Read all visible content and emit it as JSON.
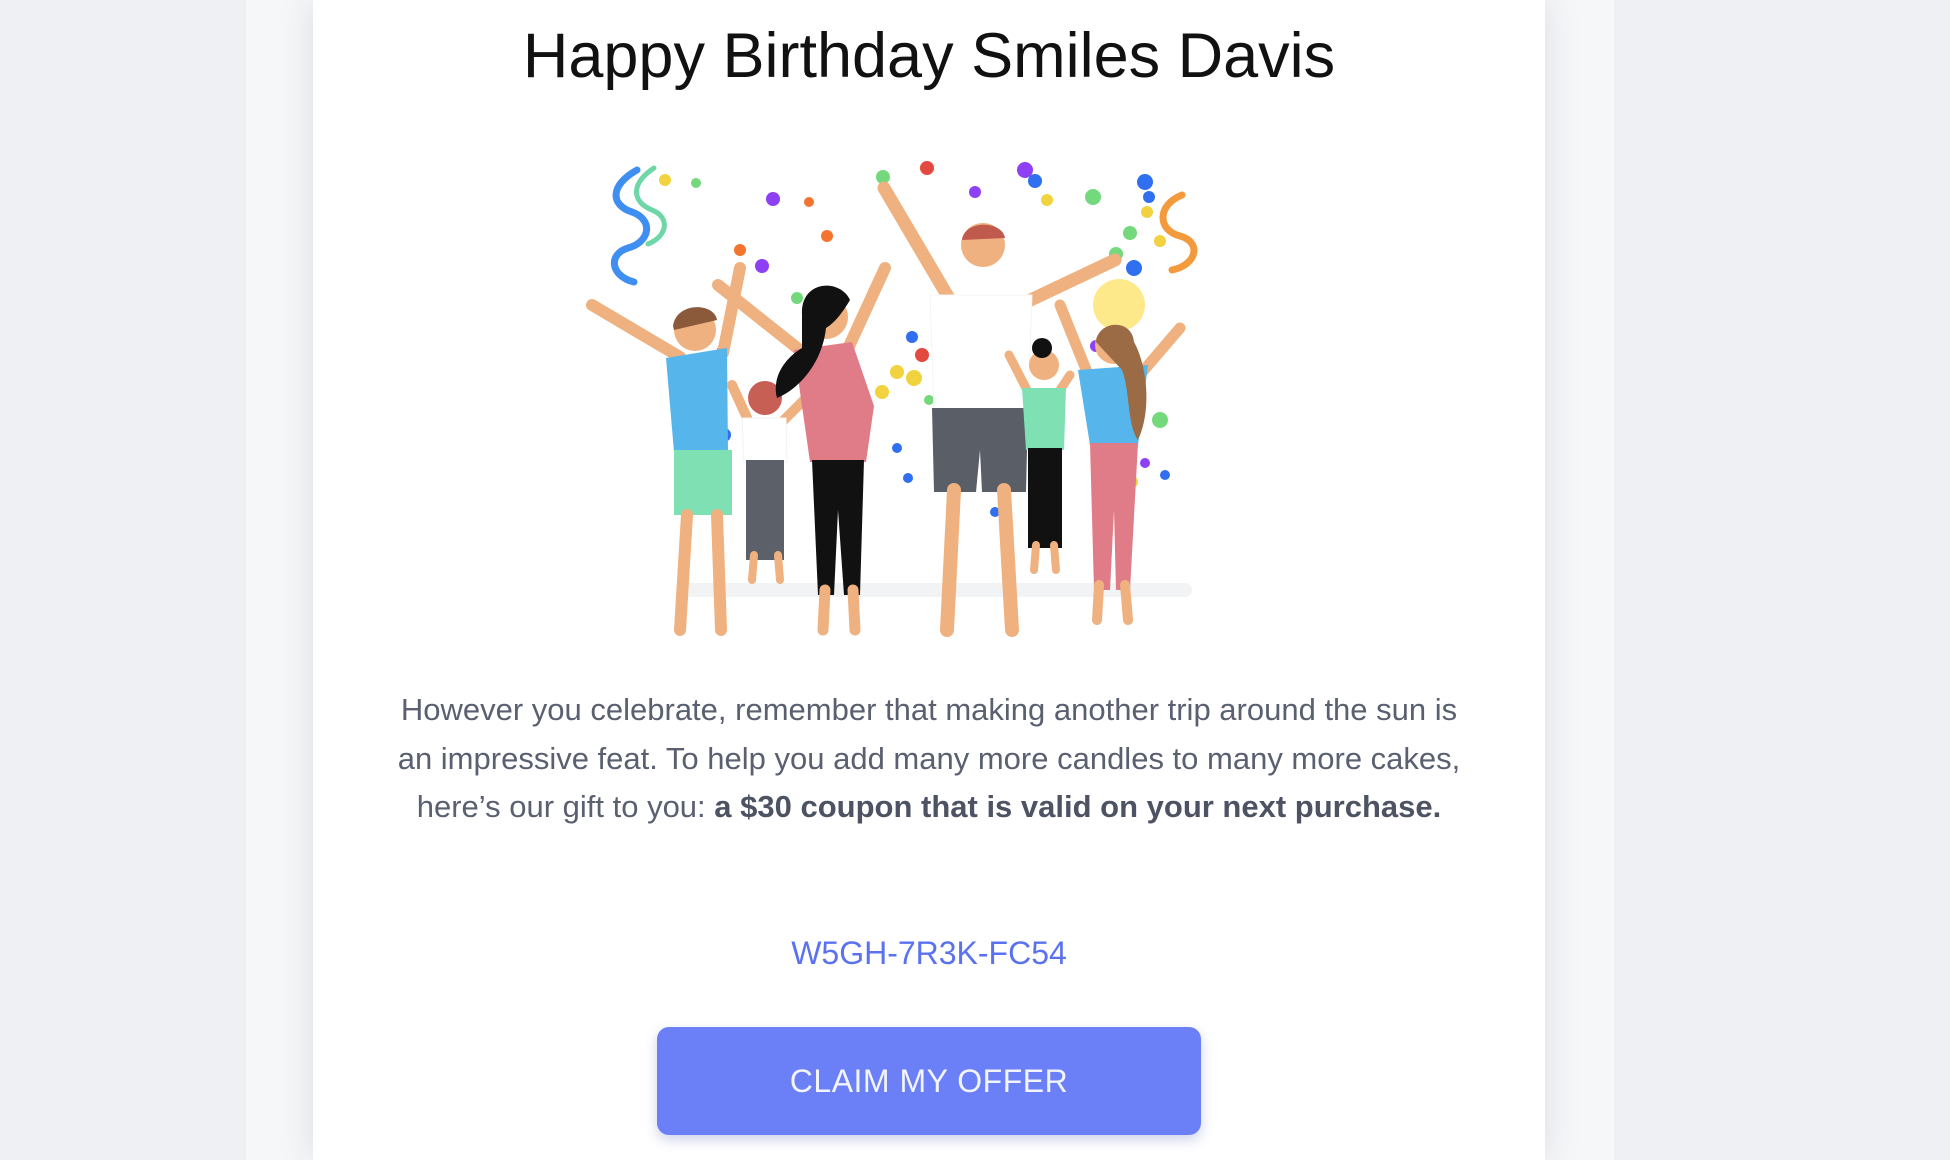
{
  "email": {
    "title": "Happy Birthday Smiles Davis",
    "message_intro": "However you celebrate, remember that making another trip around the sun is an impressive feat. To help you add many more candles to many more cakes, here’s our gift to you: ",
    "message_emphasis": "a $30 coupon that is valid on your next purchase.",
    "coupon_code": "W5GH-7R3K-FC54",
    "cta_label": "CLAIM MY OFFER"
  },
  "colors": {
    "page_background": "#eef0f3",
    "card_background": "#ffffff",
    "coupon_code": "#5b72f0",
    "cta_button": "#6b80f6",
    "body_text": "#5a6070"
  },
  "illustration": {
    "subject": "group of people celebrating with confetti and streamers"
  }
}
